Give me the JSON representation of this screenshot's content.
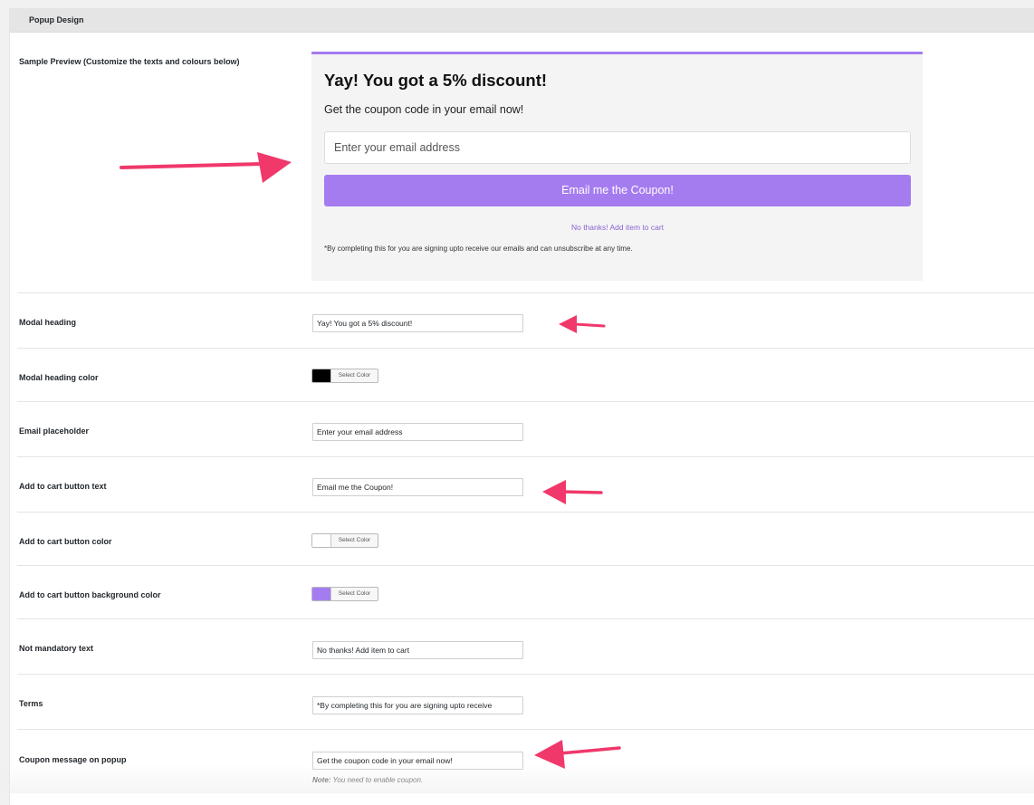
{
  "panel": {
    "title": "Popup Design"
  },
  "preview": {
    "label": "Sample Preview (Customize the texts and colours below)",
    "heading": "Yay! You got a 5% discount!",
    "subtext": "Get the coupon code in your email now!",
    "email_placeholder": "Enter your email address",
    "button_label": "Email me the Coupon!",
    "no_thanks": "No thanks! Add item to cart",
    "terms": "*By completing this for you are signing upto receive our emails and can unsubscribe at any time.",
    "accent_color": "#a57cf0",
    "background_color": "#f4f4f4"
  },
  "fields": {
    "modal_heading": {
      "label": "Modal heading",
      "value": "Yay! You got a 5% discount!"
    },
    "modal_heading_color": {
      "label": "Modal heading color",
      "button": "Select Color",
      "color": "#000000"
    },
    "email_placeholder": {
      "label": "Email placeholder",
      "value": "Enter your email address"
    },
    "cart_button_text": {
      "label": "Add to cart button text",
      "value": "Email me the Coupon!"
    },
    "cart_button_color": {
      "label": "Add to cart button color",
      "button": "Select Color",
      "color": "#ffffff"
    },
    "cart_button_bg_color": {
      "label": "Add to cart button background color",
      "button": "Select Color",
      "color": "#a57cf0"
    },
    "not_mandatory_text": {
      "label": "Not mandatory text",
      "value": "No thanks! Add item to cart"
    },
    "terms": {
      "label": "Terms",
      "value": "*By completing this for you are signing upto receive"
    },
    "coupon_message": {
      "label": "Coupon message on popup",
      "value": "Get the coupon code in your email now!",
      "note_prefix": "Note:",
      "note_text": "You need to enable coupon."
    }
  },
  "annotation_color": "#f0386b"
}
